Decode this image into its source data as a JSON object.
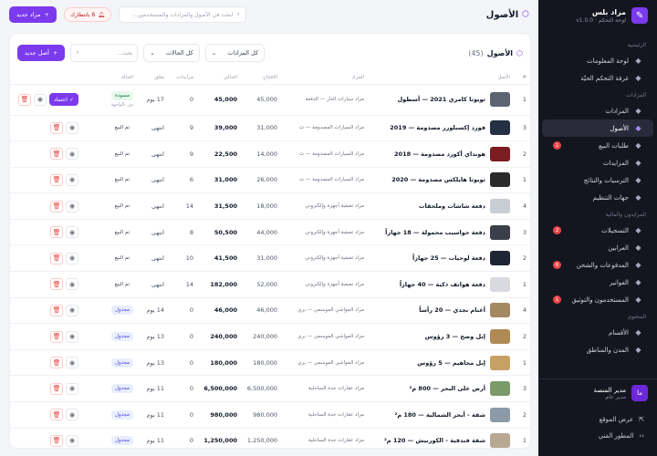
{
  "brand": {
    "name": "مزاد بلس",
    "version": "لوحة التحكم · v1.0.0"
  },
  "nav": {
    "sections": [
      "الرئيسية",
      "المزادات",
      "المزايدون والمالية",
      "المحتوى"
    ],
    "items": [
      {
        "label": "لوحة المعلومات",
        "icon": "dashboard-icon"
      },
      {
        "label": "غرفة التحكم الحيّة",
        "icon": "live-icon"
      },
      {
        "label": "المزادات",
        "icon": "gavel-icon"
      },
      {
        "label": "الأصول",
        "icon": "box-icon",
        "active": true
      },
      {
        "label": "طلبات البيع",
        "icon": "inbox-icon",
        "badge": "1"
      },
      {
        "label": "المزايدات",
        "icon": "bid-icon"
      },
      {
        "label": "الترسيات والنتائج",
        "icon": "trophy-icon"
      },
      {
        "label": "جهات التنظيم",
        "icon": "building-icon"
      },
      {
        "label": "التسجيلات",
        "icon": "register-icon",
        "badge": "2"
      },
      {
        "label": "العرابين",
        "icon": "deposit-icon"
      },
      {
        "label": "المدفوعات والشحن",
        "icon": "wallet-icon",
        "badge": "6"
      },
      {
        "label": "الفواتير",
        "icon": "invoice-icon"
      },
      {
        "label": "المستخدمون والتوثيق",
        "icon": "users-icon",
        "badge": "1"
      },
      {
        "label": "الأقسام",
        "icon": "grid-icon"
      },
      {
        "label": "المدن والمناطق",
        "icon": "map-icon"
      }
    ]
  },
  "profile": {
    "initials": "ما",
    "name": "مدير المنصة",
    "role": "مدير عام"
  },
  "sidebar_bottom": {
    "view_site": "عرض الموقع",
    "dev": "المطور الفني"
  },
  "topbar": {
    "title": "الأصول",
    "search_placeholder": "ابحث في الأصول والمزادات والمستخدمين...",
    "pending_label": "6 بانتظارك",
    "new_auction": "مزاد جديد"
  },
  "card": {
    "title": "الأصول",
    "count": "45",
    "filter_auctions": "كل المزادات",
    "filter_status": "كل الحالات",
    "search_placeholder": "بحث...",
    "add_asset": "أصل جديد"
  },
  "table": {
    "headers": [
      "#",
      "الأصل",
      "المزاد",
      "الافتتاح",
      "الحالي",
      "مزايدات",
      "يغلق",
      "الحالة",
      ""
    ],
    "approve_label": "اعتماد",
    "rows": [
      {
        "n": "1",
        "title": "تويوتا كامري 2021 — أسطول",
        "auction": "مزاد سيارات الدار — الدفعة",
        "open": "45,000",
        "current": "45,000",
        "bids": "0",
        "closes": "17 يوم",
        "status": "draft",
        "status_label": "مسودة",
        "sub": "من بالواجهة",
        "thumb": "#5b6470"
      },
      {
        "n": "3",
        "title": "فورد إكسبلورر مصدومة — 2019",
        "auction": "مزاد السيارات المصدومة — ث",
        "open": "31,000",
        "current": "39,000",
        "bids": "9",
        "closes": "انتهى",
        "status": "ended",
        "status_label": "تم البيع",
        "thumb": "#243043"
      },
      {
        "n": "2",
        "title": "هونداي أكورد مصدومة — 2018",
        "auction": "مزاد السيارات المصدومة — ث",
        "open": "14,000",
        "current": "22,500",
        "bids": "9",
        "closes": "انتهى",
        "status": "ended",
        "status_label": "تم البيع",
        "thumb": "#7a1c22"
      },
      {
        "n": "1",
        "title": "تويوتا هايلكس مصدومة — 2020",
        "auction": "مزاد السيارات المصدومة — ث",
        "open": "26,000",
        "current": "31,000",
        "bids": "6",
        "closes": "انتهى",
        "status": "ended",
        "status_label": "تم البيع",
        "thumb": "#2b2b2b"
      },
      {
        "n": "4",
        "title": "دفعة شاشات وملحقات",
        "auction": "مزاد تصفية أجهزة وإلكتروني",
        "open": "18,000",
        "current": "31,500",
        "bids": "14",
        "closes": "انتهى",
        "status": "ended",
        "status_label": "تم البيع",
        "thumb": "#c9cdd4"
      },
      {
        "n": "3",
        "title": "دفعة حواسيب محمولة — 18 جهازاً",
        "auction": "مزاد تصفية أجهزة وإلكتروني",
        "open": "44,000",
        "current": "50,500",
        "bids": "8",
        "closes": "انتهى",
        "status": "ended",
        "status_label": "تم البيع",
        "thumb": "#3a3f4a"
      },
      {
        "n": "2",
        "title": "دفعة لوحيات — 25 جهازاً",
        "auction": "مزاد تصفية أجهزة وإلكتروني",
        "open": "31,000",
        "current": "41,500",
        "bids": "10",
        "closes": "انتهى",
        "status": "ended",
        "status_label": "تم البيع",
        "thumb": "#1f2633"
      },
      {
        "n": "1",
        "title": "دفعة هواتف ذكية — 40 جهازاً",
        "auction": "مزاد تصفية أجهزة وإلكتروني",
        "open": "52,000",
        "current": "182,000",
        "bids": "14",
        "closes": "انتهى",
        "status": "ended",
        "status_label": "تم البيع",
        "thumb": "#d9dadf"
      },
      {
        "n": "4",
        "title": "أغنام نجدي — 20 رأساً",
        "auction": "مزاد المواشي الموسمي — بري",
        "open": "46,000",
        "current": "46,000",
        "bids": "0",
        "closes": "14 يوم",
        "status": "scheduled",
        "status_label": "مجدول",
        "thumb": "#a38861"
      },
      {
        "n": "2",
        "title": "إبل وضح — 3 رؤوس",
        "auction": "مزاد المواشي الموسمي — بري",
        "open": "240,000",
        "current": "240,000",
        "bids": "0",
        "closes": "13 يوم",
        "status": "scheduled",
        "status_label": "مجدول",
        "thumb": "#b08a55"
      },
      {
        "n": "1",
        "title": "إبل مجاهيم — 5 رؤوس",
        "auction": "مزاد المواشي الموسمي — بري",
        "open": "180,000",
        "current": "180,000",
        "bids": "0",
        "closes": "13 يوم",
        "status": "scheduled",
        "status_label": "مجدول",
        "thumb": "#c7a063"
      },
      {
        "n": "3",
        "title": "أرض على البحر — 800 م²",
        "auction": "مزاد عقارات جدة الساحلية",
        "open": "6,500,000",
        "current": "6,500,000",
        "bids": "0",
        "closes": "11 يوم",
        "status": "scheduled",
        "status_label": "مجدول",
        "thumb": "#7b9a6a"
      },
      {
        "n": "2",
        "title": "شقة - أبحر الشمالية — 180 م²",
        "auction": "مزاد عقارات جدة الساحلية",
        "open": "980,000",
        "current": "980,000",
        "bids": "0",
        "closes": "11 يوم",
        "status": "scheduled",
        "status_label": "مجدول",
        "thumb": "#8d9aa8"
      },
      {
        "n": "1",
        "title": "شقة فندقية - الكورنيش — 120 م²",
        "auction": "مزاد عقارات جدة الساحلية",
        "open": "1,250,000",
        "current": "1,250,000",
        "bids": "0",
        "closes": "11 يوم",
        "status": "scheduled",
        "status_label": "مجدول",
        "thumb": "#b7a891"
      }
    ]
  },
  "colors": {
    "accent": "#7c3aed",
    "sidebar": "#14151f",
    "danger": "#ef4444"
  }
}
